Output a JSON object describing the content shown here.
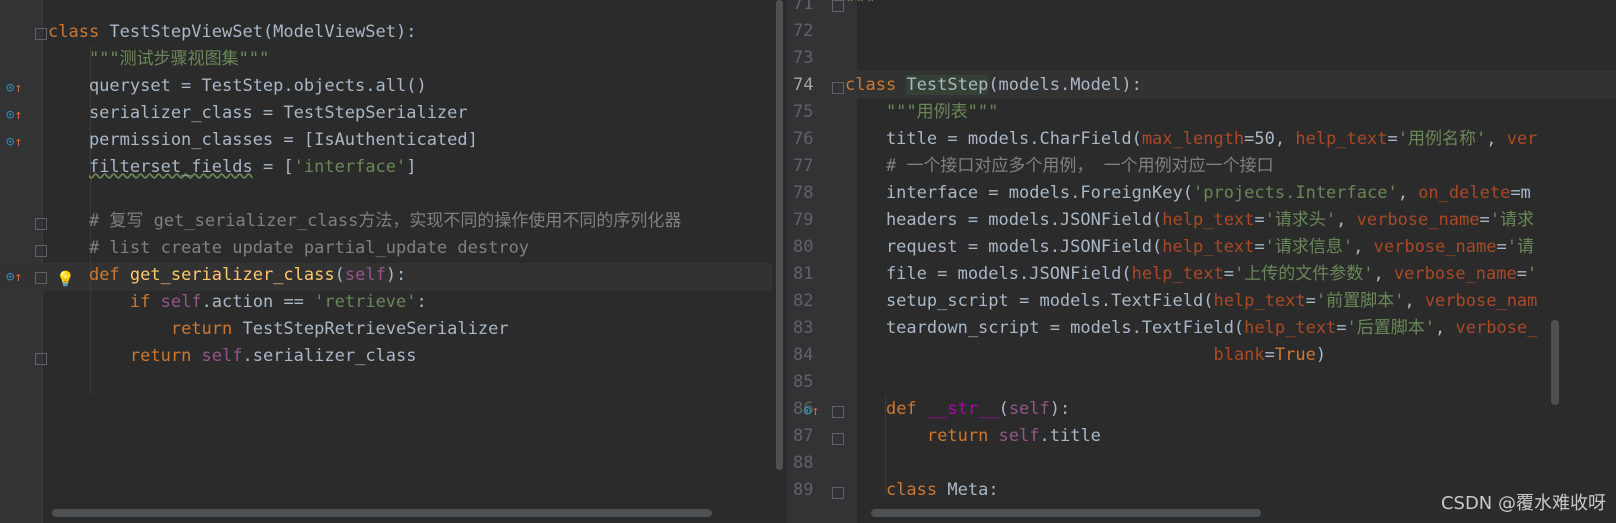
{
  "left_editor": {
    "lines": [
      {
        "segments": [
          {
            "t": "class ",
            "c": "kw"
          },
          {
            "t": "TestStepViewSet(ModelViewSet):",
            "c": ""
          }
        ]
      },
      {
        "segments": [
          {
            "t": "    \"\"\"测试步骤视图集\"\"\"",
            "c": "str"
          }
        ]
      },
      {
        "segments": [
          {
            "t": "    queryset = TestStep.objects.all()",
            "c": ""
          }
        ]
      },
      {
        "segments": [
          {
            "t": "    serializer_class = TestStepSerializer",
            "c": ""
          }
        ]
      },
      {
        "segments": [
          {
            "t": "    permission_classes = [IsAuthenticated]",
            "c": ""
          }
        ]
      },
      {
        "segments": [
          {
            "t": "    ",
            "c": ""
          },
          {
            "t": "filterset_fields",
            "c": "squig"
          },
          {
            "t": " = [",
            "c": ""
          },
          {
            "t": "'interface'",
            "c": "str"
          },
          {
            "t": "]",
            "c": ""
          }
        ]
      },
      {
        "segments": [
          {
            "t": "",
            "c": ""
          }
        ]
      },
      {
        "segments": [
          {
            "t": "    # 复写 get_serializer_class方法，实现不同的操作使用不同的序列化器",
            "c": "cm"
          }
        ]
      },
      {
        "segments": [
          {
            "t": "    # list create update partial_update destroy",
            "c": "cm"
          }
        ]
      },
      {
        "segments": [
          {
            "t": "    ",
            "c": ""
          },
          {
            "t": "def ",
            "c": "kw"
          },
          {
            "t": "get_serializer_class",
            "c": "fn"
          },
          {
            "t": "(",
            "c": ""
          },
          {
            "t": "self",
            "c": "self"
          },
          {
            "t": "):",
            "c": ""
          }
        ]
      },
      {
        "segments": [
          {
            "t": "        ",
            "c": ""
          },
          {
            "t": "if ",
            "c": "kw"
          },
          {
            "t": "self",
            "c": "self"
          },
          {
            "t": ".action == ",
            "c": ""
          },
          {
            "t": "'retrieve'",
            "c": "str"
          },
          {
            "t": ":",
            "c": ""
          }
        ]
      },
      {
        "segments": [
          {
            "t": "            ",
            "c": ""
          },
          {
            "t": "return ",
            "c": "kw"
          },
          {
            "t": "TestStepRetrieveSerializer",
            "c": ""
          }
        ]
      },
      {
        "segments": [
          {
            "t": "        ",
            "c": ""
          },
          {
            "t": "return ",
            "c": "kw"
          },
          {
            "t": "self",
            "c": "self"
          },
          {
            "t": ".serializer_class",
            "c": ""
          }
        ]
      }
    ]
  },
  "right_editor": {
    "line_numbers": [
      "71",
      "72",
      "73",
      "74",
      "75",
      "76",
      "77",
      "78",
      "79",
      "80",
      "81",
      "82",
      "83",
      "84",
      "85",
      "86",
      "87",
      "88",
      "89"
    ],
    "current_line": "74",
    "lines": [
      {
        "segments": [
          {
            "t": "\"\"\"",
            "c": "str"
          }
        ]
      },
      {
        "segments": [
          {
            "t": "",
            "c": ""
          }
        ]
      },
      {
        "segments": [
          {
            "t": "",
            "c": ""
          }
        ]
      },
      {
        "segments": [
          {
            "t": "class ",
            "c": "kw"
          },
          {
            "t": "TestStep",
            "c": "hl"
          },
          {
            "t": "(models.Model):",
            "c": ""
          }
        ]
      },
      {
        "segments": [
          {
            "t": "    \"\"\"用例表\"\"\"",
            "c": "str"
          }
        ]
      },
      {
        "segments": [
          {
            "t": "    title = models.CharField(",
            "c": ""
          },
          {
            "t": "max_length",
            "c": "param"
          },
          {
            "t": "=50, ",
            "c": ""
          },
          {
            "t": "help_text",
            "c": "param"
          },
          {
            "t": "=",
            "c": ""
          },
          {
            "t": "'用例名称'",
            "c": "str"
          },
          {
            "t": ", ",
            "c": ""
          },
          {
            "t": "ver",
            "c": "param"
          }
        ]
      },
      {
        "segments": [
          {
            "t": "    # 一个接口对应多个用例， 一个用例对应一个接口",
            "c": "cm"
          }
        ]
      },
      {
        "segments": [
          {
            "t": "    interface = models.ForeignKey(",
            "c": ""
          },
          {
            "t": "'projects.Interface'",
            "c": "str"
          },
          {
            "t": ", ",
            "c": ""
          },
          {
            "t": "on_delete",
            "c": "param"
          },
          {
            "t": "=m",
            "c": ""
          }
        ]
      },
      {
        "segments": [
          {
            "t": "    headers = models.JSONField(",
            "c": ""
          },
          {
            "t": "help_text",
            "c": "param"
          },
          {
            "t": "=",
            "c": ""
          },
          {
            "t": "'请求头'",
            "c": "str"
          },
          {
            "t": ", ",
            "c": ""
          },
          {
            "t": "verbose_name",
            "c": "param"
          },
          {
            "t": "=",
            "c": ""
          },
          {
            "t": "'请求",
            "c": "str"
          }
        ]
      },
      {
        "segments": [
          {
            "t": "    request = models.JSONField(",
            "c": ""
          },
          {
            "t": "help_text",
            "c": "param"
          },
          {
            "t": "=",
            "c": ""
          },
          {
            "t": "'请求信息'",
            "c": "str"
          },
          {
            "t": ", ",
            "c": ""
          },
          {
            "t": "verbose_name",
            "c": "param"
          },
          {
            "t": "=",
            "c": ""
          },
          {
            "t": "'请",
            "c": "str"
          }
        ]
      },
      {
        "segments": [
          {
            "t": "    file = models.JSONField(",
            "c": ""
          },
          {
            "t": "help_text",
            "c": "param"
          },
          {
            "t": "=",
            "c": ""
          },
          {
            "t": "'上传的文件参数'",
            "c": "str"
          },
          {
            "t": ", ",
            "c": ""
          },
          {
            "t": "verbose_name",
            "c": "param"
          },
          {
            "t": "=",
            "c": ""
          },
          {
            "t": "'",
            "c": "str"
          }
        ]
      },
      {
        "segments": [
          {
            "t": "    setup_script = models.TextField(",
            "c": ""
          },
          {
            "t": "help_text",
            "c": "param"
          },
          {
            "t": "=",
            "c": ""
          },
          {
            "t": "'前置脚本'",
            "c": "str"
          },
          {
            "t": ", ",
            "c": ""
          },
          {
            "t": "verbose_nam",
            "c": "param"
          }
        ]
      },
      {
        "segments": [
          {
            "t": "    teardown_script = models.TextField(",
            "c": ""
          },
          {
            "t": "help_text",
            "c": "param"
          },
          {
            "t": "=",
            "c": ""
          },
          {
            "t": "'后置脚本'",
            "c": "str"
          },
          {
            "t": ", ",
            "c": ""
          },
          {
            "t": "verbose_",
            "c": "param"
          }
        ]
      },
      {
        "segments": [
          {
            "t": "                                    ",
            "c": ""
          },
          {
            "t": "blank",
            "c": "param"
          },
          {
            "t": "=",
            "c": ""
          },
          {
            "t": "True",
            "c": "kw"
          },
          {
            "t": ")",
            "c": ""
          }
        ]
      },
      {
        "segments": [
          {
            "t": "",
            "c": ""
          }
        ]
      },
      {
        "segments": [
          {
            "t": "    ",
            "c": ""
          },
          {
            "t": "def ",
            "c": "kw"
          },
          {
            "t": "__str__",
            "c": "dunder"
          },
          {
            "t": "(",
            "c": ""
          },
          {
            "t": "self",
            "c": "self"
          },
          {
            "t": "):",
            "c": ""
          }
        ]
      },
      {
        "segments": [
          {
            "t": "        ",
            "c": ""
          },
          {
            "t": "return ",
            "c": "kw"
          },
          {
            "t": "self",
            "c": "self"
          },
          {
            "t": ".title",
            "c": ""
          }
        ]
      },
      {
        "segments": [
          {
            "t": "",
            "c": ""
          }
        ]
      },
      {
        "segments": [
          {
            "t": "    ",
            "c": ""
          },
          {
            "t": "class ",
            "c": "kw"
          },
          {
            "t": "Meta:",
            "c": ""
          }
        ]
      }
    ]
  },
  "watermark": "CSDN @覆水难收呀",
  "colors": {
    "background": "#2b2b2b",
    "keyword": "#cc7832",
    "string": "#6a8759",
    "comment": "#808080",
    "self": "#94558d",
    "function": "#ffc66d",
    "param": "#aa4926"
  },
  "icons": [
    "override-icon",
    "fold-icon",
    "lightbulb-icon"
  ]
}
